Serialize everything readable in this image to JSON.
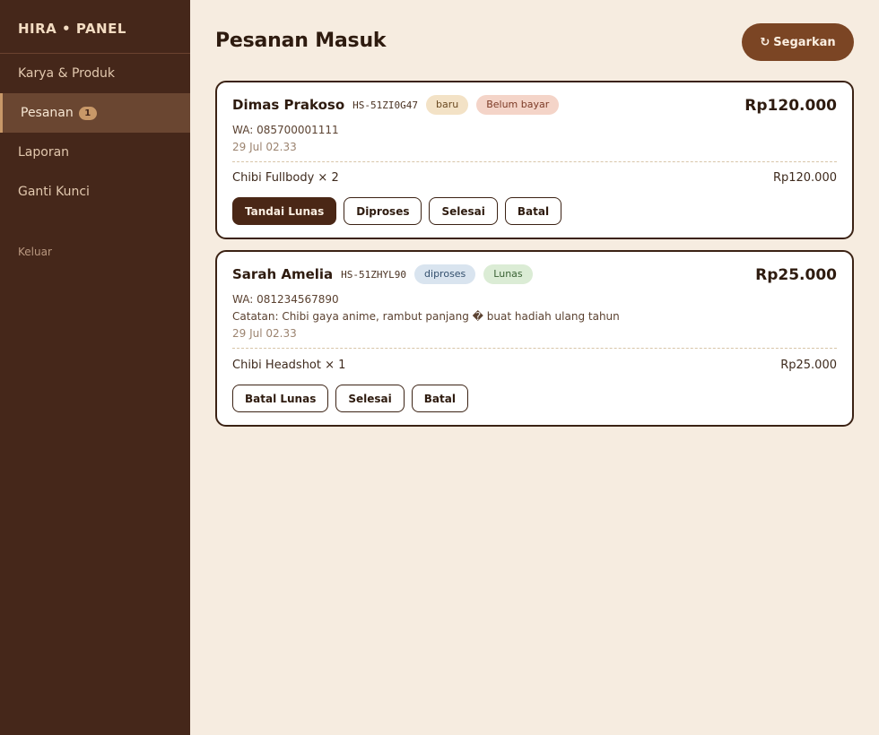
{
  "sidebar": {
    "brand": "HIRA • PANEL",
    "items": [
      {
        "label": "Karya & Produk"
      },
      {
        "label": "Pesanan",
        "badge": "1"
      },
      {
        "label": "Laporan"
      },
      {
        "label": "Ganti Kunci"
      }
    ],
    "logout": "Keluar"
  },
  "header": {
    "title": "Pesanan Masuk",
    "refresh_icon": "↻",
    "refresh_label": "Segarkan"
  },
  "orders": [
    {
      "customer": "Dimas Prakoso",
      "code": "HS-51ZI0G47",
      "status": "baru",
      "payment": "Belum bayar",
      "total": "Rp120.000",
      "wa": "WA: 085700001111",
      "date": "29 Jul 02.33",
      "item": "Chibi Fullbody × 2",
      "item_price": "Rp120.000",
      "actions": [
        "Tandai Lunas",
        "Diproses",
        "Selesai",
        "Batal"
      ]
    },
    {
      "customer": "Sarah Amelia",
      "code": "HS-51ZHYL90",
      "status": "diproses",
      "payment": "Lunas",
      "total": "Rp25.000",
      "wa": "WA: 081234567890",
      "note": "Catatan: Chibi gaya anime, rambut panjang � buat hadiah ulang tahun",
      "date": "29 Jul 02.33",
      "item": "Chibi Headshot × 1",
      "item_price": "Rp25.000",
      "actions": [
        "Batal Lunas",
        "Selesai",
        "Batal"
      ]
    }
  ],
  "colors": {
    "sidebar_bg": "#45271a",
    "page_bg": "#f6ece0",
    "accent": "#7b4524",
    "primary_button": "#4a2716"
  }
}
